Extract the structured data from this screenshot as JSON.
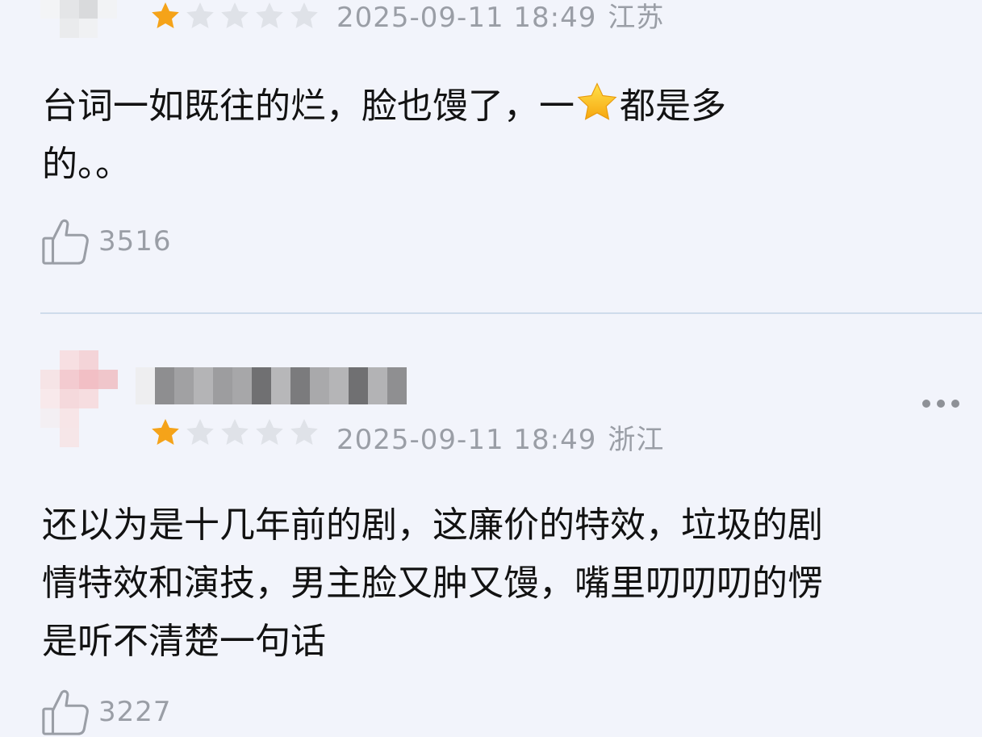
{
  "comments": [
    {
      "rating": 1,
      "max_rating": 5,
      "timestamp": "2025-09-11 18:49",
      "region": "江苏",
      "content_before_emoji": "台词一如既往的烂，脸也馒了，一",
      "emoji": "star-emoji",
      "content_after_emoji": "都是多\n的。。",
      "likes": "3516"
    },
    {
      "rating": 1,
      "max_rating": 5,
      "timestamp": "2025-09-11 18:49",
      "region": "浙江",
      "content": "还以为是十几年前的剧，这廉价的特效，垃圾的剧\n情特效和演技，男主脸又肿又馒，嘴里叨叨叨的愣\n是听不清楚一句话",
      "likes": "3227"
    }
  ],
  "icons": {
    "more": "more-options-icon",
    "like": "thumbs-up-icon",
    "star_filled": "star-filled-icon",
    "star_empty": "star-empty-icon"
  },
  "colors": {
    "background": "#f2f4fb",
    "star_filled": "#f5a319",
    "star_empty": "#dfe2e8",
    "meta_text": "#9a9ea6",
    "divider": "#cfdceb"
  }
}
